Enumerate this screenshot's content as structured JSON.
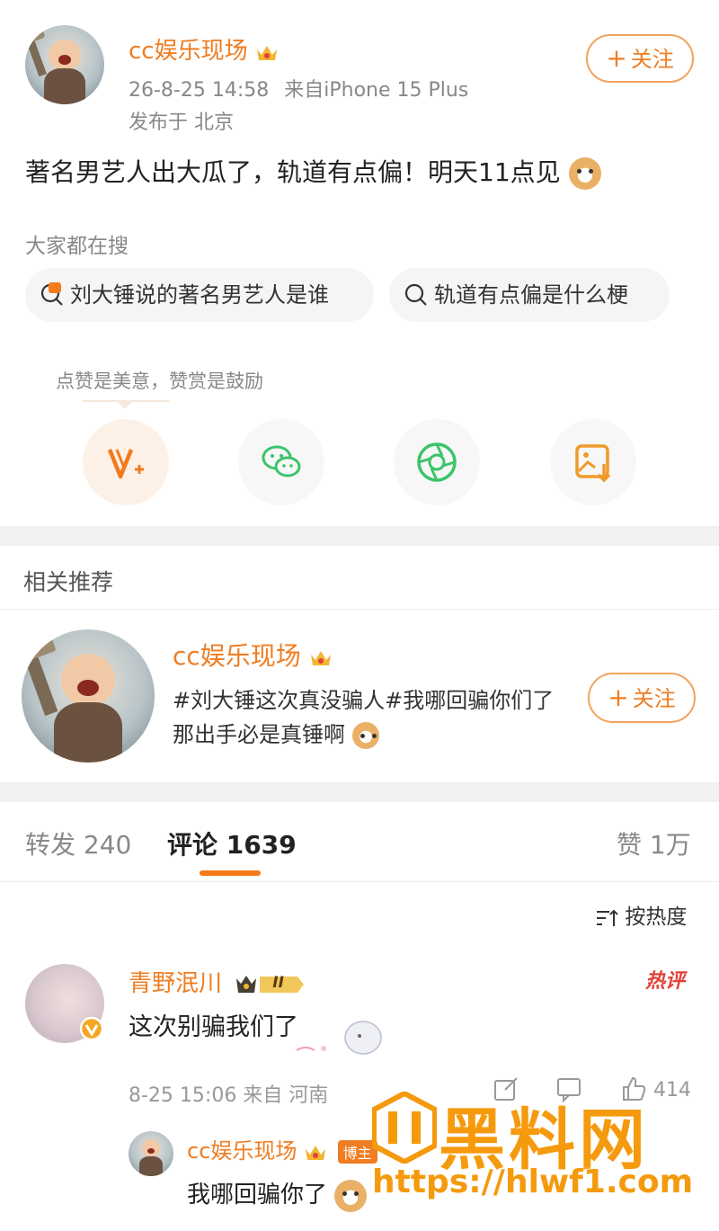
{
  "post": {
    "author": "cc娱乐现场",
    "time": "26-8-25 14:58",
    "source": "来自iPhone 15 Plus",
    "location": "发布于 北京",
    "follow_label": "关注",
    "content": "著名男艺人出大瓜了，轨道有点偏！明天11点见"
  },
  "searching": {
    "label": "大家都在搜",
    "chips": [
      "刘大锤说的著名男艺人是谁",
      "轨道有点偏是什么梗"
    ]
  },
  "actions": {
    "tip": "点赞是美意，赞赏是鼓励",
    "icons": [
      "reward-icon",
      "wechat-icon",
      "moments-icon",
      "save-image-icon"
    ]
  },
  "related": {
    "title": "相关推荐",
    "author": "cc娱乐现场",
    "text": "#刘大锤这次真没骗人#我哪回骗你们了 那出手必是真锤啊",
    "follow_label": "关注"
  },
  "tabs": {
    "repost": "转发 240",
    "comments": "评论 1639",
    "likes": "赞 1万"
  },
  "sort_label": "按热度",
  "comment": {
    "author": "青野泯川",
    "level": "II",
    "hot_tag": "热评",
    "text": "这次别骗我们了",
    "meta": "8-25 15:06 来自 河南",
    "like_count": "414"
  },
  "reply": {
    "author": "cc娱乐现场",
    "badge": "博主",
    "text": "我哪回骗你了"
  },
  "watermark": {
    "title": "黑料网",
    "url": "https://hlwf1.com"
  },
  "colors": {
    "accent": "#ef7d22",
    "hot": "#e3403a",
    "wechat_green": "#3cc46a"
  }
}
